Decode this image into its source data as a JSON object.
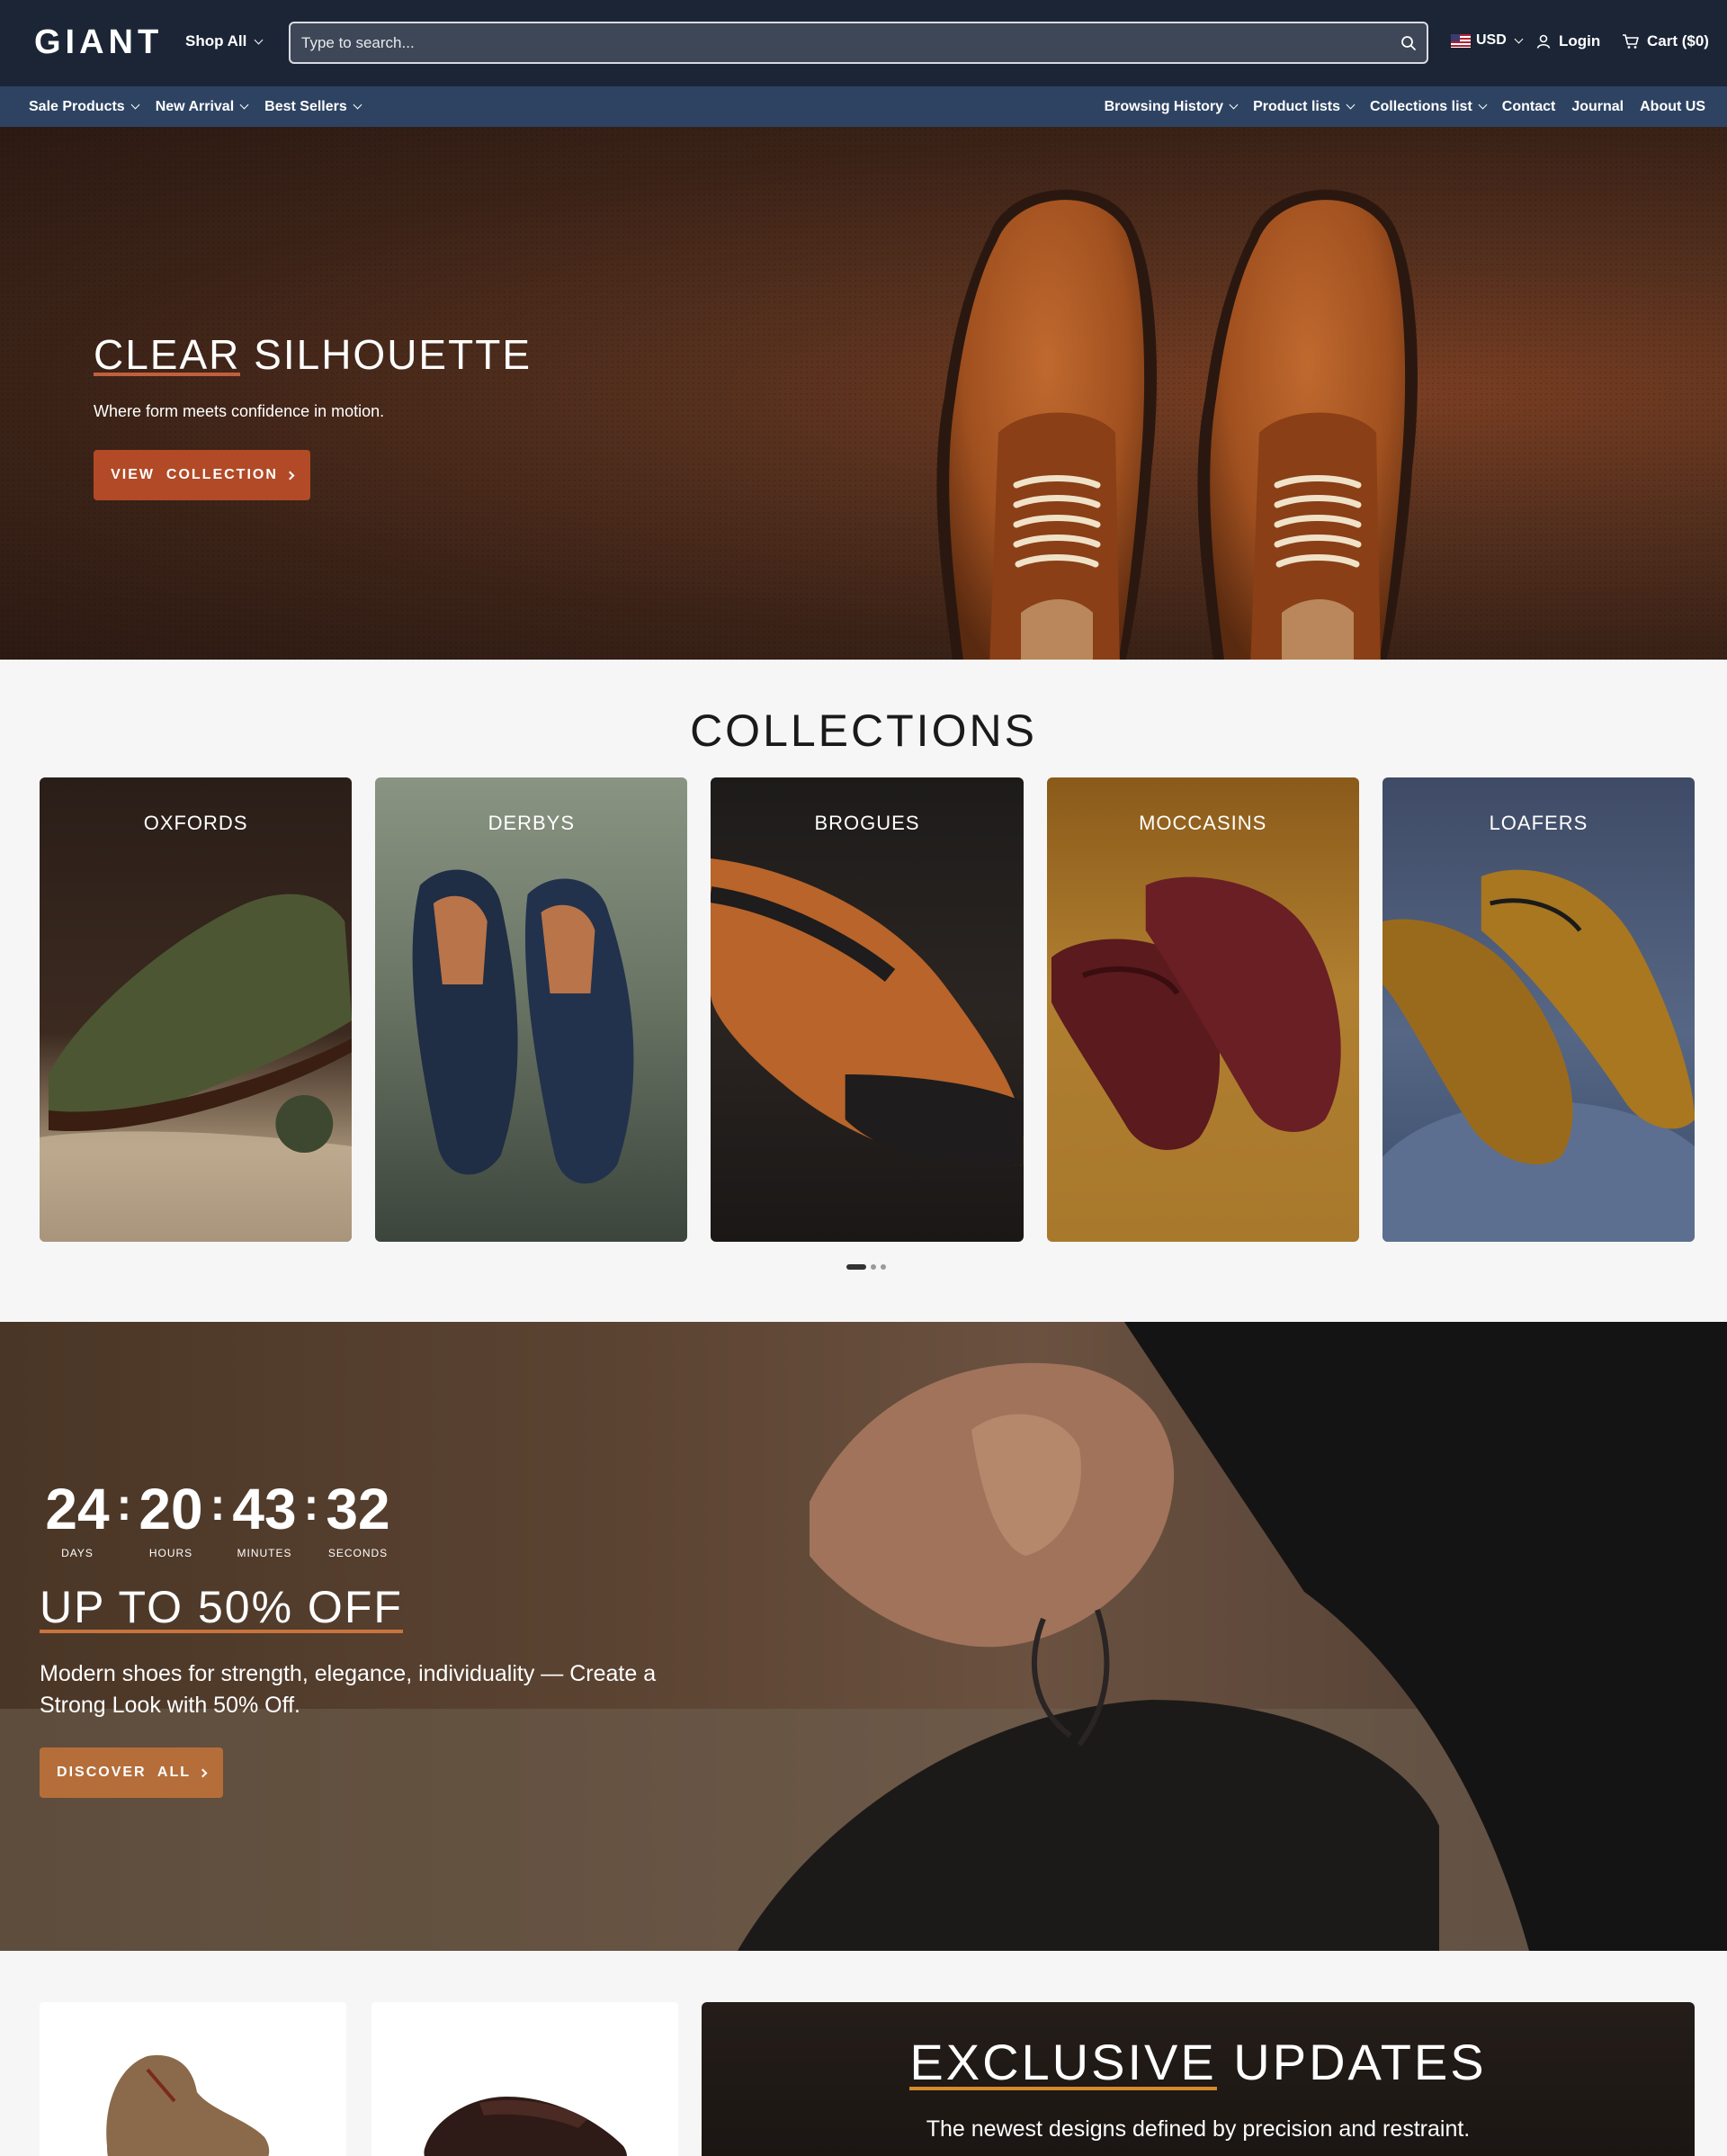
{
  "header": {
    "logo": "GIANT",
    "shop_all": "Shop All",
    "search_placeholder": "Type to search...",
    "currency": "USD",
    "login": "Login",
    "cart": "Cart ($0)"
  },
  "nav": {
    "left": [
      {
        "label": "Sale Products",
        "dropdown": true
      },
      {
        "label": "New Arrival",
        "dropdown": true
      },
      {
        "label": "Best Sellers",
        "dropdown": true
      }
    ],
    "right": [
      {
        "label": "Browsing History",
        "dropdown": true
      },
      {
        "label": "Product lists",
        "dropdown": true
      },
      {
        "label": "Collections list",
        "dropdown": true
      },
      {
        "label": "Contact",
        "dropdown": false
      },
      {
        "label": "Journal",
        "dropdown": false
      },
      {
        "label": "About US",
        "dropdown": false
      }
    ]
  },
  "hero": {
    "title_highlight": "CLEAR",
    "title_rest": " SILHOUETTE",
    "subtitle": "Where form meets confidence in motion.",
    "button": "VIEW  COLLECTION"
  },
  "collections": {
    "title": "COLLECTIONS",
    "items": [
      {
        "label": "OXFORDS"
      },
      {
        "label": "DERBYS"
      },
      {
        "label": "BROGUES"
      },
      {
        "label": "MOCCASINS"
      },
      {
        "label": "LOAFERS"
      }
    ],
    "pagination": {
      "pages": 3,
      "active": 1
    }
  },
  "sale": {
    "countdown": {
      "days": "24",
      "hours": "20",
      "minutes": "43",
      "seconds": "32",
      "days_label": "DAYS",
      "hours_label": "HOURS",
      "minutes_label": "MINUTES",
      "seconds_label": "SECONDS"
    },
    "title": "UP TO 50% OFF",
    "description": "Modern shoes for strength, elegance, individuality — Create a Strong Look with 50% Off.",
    "button": "DISCOVER  ALL"
  },
  "exclusive": {
    "title_highlight": "EXCLUSIVE",
    "title_rest": " UPDATES",
    "subtitle": "The newest designs defined by precision and restraint."
  },
  "colors": {
    "header_bg": "#1b2536",
    "nav_bg": "#2e4362",
    "hero_button": "#b24a27",
    "sale_button": "#b56e3a",
    "accent_underline": "#d38a2a"
  }
}
